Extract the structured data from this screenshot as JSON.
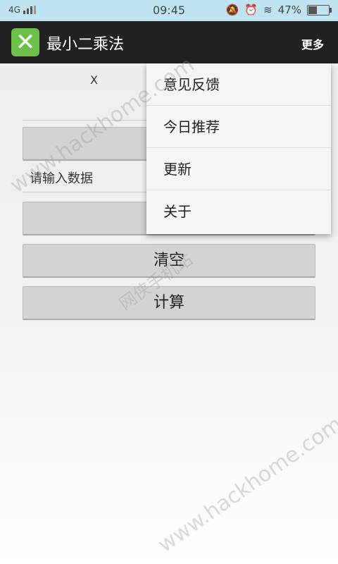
{
  "status_bar": {
    "network": "4G",
    "time": "09:45",
    "battery": "47%",
    "battery_level": 0.47,
    "icons": [
      "signal-icon",
      "mute-icon",
      "alarm-icon",
      "wifi-icon",
      "battery-icon"
    ]
  },
  "app_bar": {
    "icon": "x-logo-icon",
    "icon_color": "#6cc04a",
    "title": "最小二乘法",
    "more_label": "更多"
  },
  "main": {
    "x_label": "X",
    "input_placeholder": "请输入数据",
    "clear_label": "清空",
    "calc_label": "计算"
  },
  "menu": {
    "items": [
      {
        "label": "意见反馈"
      },
      {
        "label": "今日推荐"
      },
      {
        "label": "更新"
      },
      {
        "label": "关于"
      }
    ]
  },
  "watermark": {
    "text": "www.hackhome.com",
    "text2": "网侠手机站"
  },
  "colors": {
    "status_bar": "#bfe3f1",
    "app_bar": "#222222",
    "button": "#d3d3d3"
  }
}
